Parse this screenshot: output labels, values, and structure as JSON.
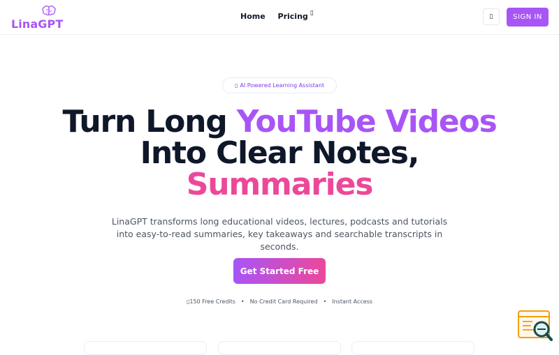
{
  "header": {
    "logo_text": "LinaGPT",
    "logo_icon": "brain-icon",
    "nav": {
      "home": "Home",
      "pricing": "Pricing",
      "pricing_icon": "chevron-down-icon"
    },
    "theme_toggle_glyph": "▯",
    "theme_toggle_icon": "moon-icon",
    "sign_in": "SIGN IN"
  },
  "hero": {
    "badge_glyph": "▯",
    "badge_text": "AI Powered Learning Assistant",
    "headline": {
      "line1_dark": "Turn Long ",
      "line1_accent": "YouTube Videos",
      "line2": "Into Clear Notes,",
      "line3": "Summaries"
    },
    "subtitle": "LinaGPT transforms long educational videos, lectures, podcasts and tutorials into easy-to-read summaries, key takeaways and searchable transcripts in seconds.",
    "cta": "Get Started Free",
    "perks": {
      "glyph": "▯",
      "credits": "150 Free Credits",
      "no_card": "No Credit Card Required",
      "access": "Instant Access",
      "separator": "•"
    }
  },
  "colors": {
    "brand": "#a855f7",
    "accent_pink": "#ec4899",
    "text_dark": "#0f172a"
  },
  "floating_widget_icon": "search-document-icon"
}
